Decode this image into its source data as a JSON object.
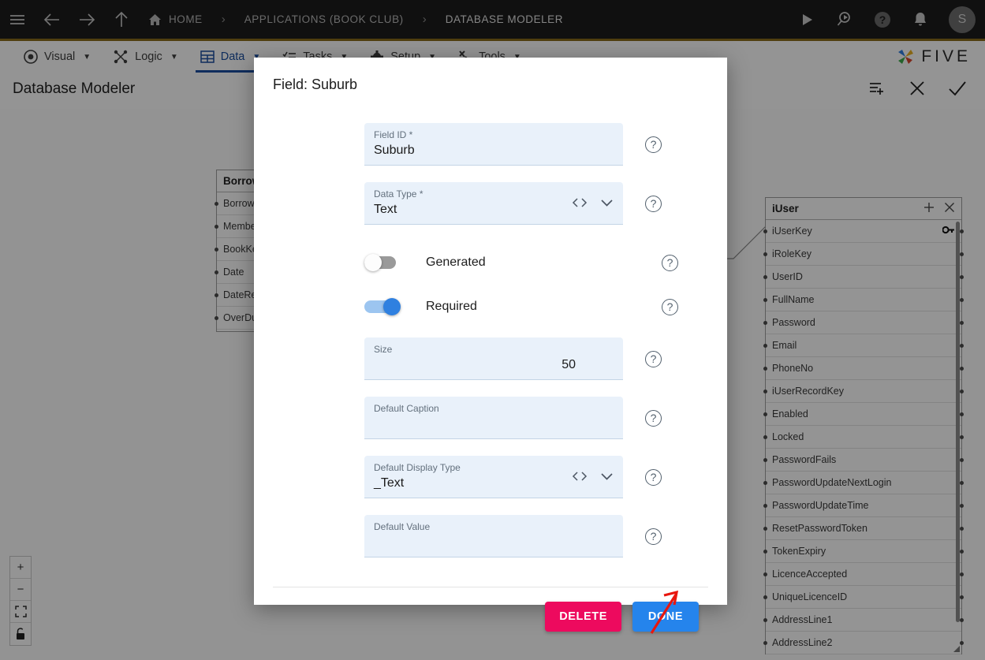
{
  "header": {
    "menu_icon": "hamburger-icon",
    "back_icon": "arrow-left-icon",
    "forward_icon": "arrow-right-icon",
    "up_icon": "arrow-up-icon",
    "breadcrumbs": [
      {
        "label": "HOME",
        "icon": "home-icon"
      },
      {
        "label": "APPLICATIONS (BOOK CLUB)"
      },
      {
        "label": "DATABASE MODELER"
      }
    ],
    "separator": "›",
    "actions": [
      {
        "name": "run-icon",
        "glyph": "play"
      },
      {
        "name": "search-icon",
        "glyph": "search"
      },
      {
        "name": "help-icon",
        "glyph": "question"
      },
      {
        "name": "notifications-icon",
        "glyph": "bell"
      }
    ],
    "avatar_initial": "S"
  },
  "modulebar": {
    "items": [
      {
        "label": "Visual",
        "icon": "eye-icon",
        "caret": "▼",
        "active": false
      },
      {
        "label": "Logic",
        "icon": "logic-nodes-icon",
        "caret": "▼",
        "active": false
      },
      {
        "label": "Data",
        "icon": "table-grid-icon",
        "caret": "▼",
        "active": true
      },
      {
        "label": "Tasks",
        "icon": "checklist-icon",
        "caret": "▼",
        "active": false
      },
      {
        "label": "Setup",
        "icon": "gear-icon",
        "caret": "▼",
        "active": false
      },
      {
        "label": "Tools",
        "icon": "wrench-icon",
        "caret": "▼",
        "active": false
      }
    ],
    "brand": "FIVE"
  },
  "page": {
    "title": "Database Modeler",
    "actions": [
      {
        "name": "add-record-icon",
        "glyph": "list-plus"
      },
      {
        "name": "close-icon",
        "glyph": "x"
      },
      {
        "name": "save-check-icon",
        "glyph": "check"
      }
    ]
  },
  "canvas": {
    "zoom_controls": [
      {
        "name": "zoom-in-button",
        "glyph": "+"
      },
      {
        "name": "zoom-out-button",
        "glyph": "−"
      },
      {
        "name": "fit-to-screen-button",
        "glyph": "fit"
      },
      {
        "name": "lock-canvas-button",
        "glyph": "lock"
      }
    ],
    "tables": [
      {
        "name": "BorrowHistory",
        "title": "BorrowH",
        "fields": [
          "BorrowH",
          "Member",
          "BookKey",
          "Date",
          "DateRetu",
          "OverDue"
        ]
      },
      {
        "name": "iUser",
        "title": "iUser",
        "add_icon": "plus-icon",
        "close_icon": "close-icon",
        "primary_key_icon": "key-icon",
        "fields": [
          {
            "label": "iUserKey",
            "key": true
          },
          {
            "label": "iRoleKey",
            "key": false
          },
          {
            "label": "UserID",
            "key": false
          },
          {
            "label": "FullName",
            "key": false
          },
          {
            "label": "Password",
            "key": false
          },
          {
            "label": "Email",
            "key": false
          },
          {
            "label": "PhoneNo",
            "key": false
          },
          {
            "label": "iUserRecordKey",
            "key": false
          },
          {
            "label": "Enabled",
            "key": false
          },
          {
            "label": "Locked",
            "key": false
          },
          {
            "label": "PasswordFails",
            "key": false
          },
          {
            "label": "PasswordUpdateNextLogin",
            "key": false
          },
          {
            "label": "PasswordUpdateTime",
            "key": false
          },
          {
            "label": "ResetPasswordToken",
            "key": false
          },
          {
            "label": "TokenExpiry",
            "key": false
          },
          {
            "label": "LicenceAccepted",
            "key": false
          },
          {
            "label": "UniqueLicenceID",
            "key": false
          },
          {
            "label": "AddressLine1",
            "key": false
          },
          {
            "label": "AddressLine2",
            "key": false
          }
        ]
      }
    ]
  },
  "modal": {
    "title": "Field: Suburb",
    "help_icon": "help-circle-icon",
    "code_icon": "code-brackets-icon",
    "dropdown_icon": "chevron-down-icon",
    "fields": [
      {
        "label": "Field ID *",
        "value": "Suburb",
        "type": "text",
        "placeholder": ""
      },
      {
        "label": "Data Type *",
        "value": "Text",
        "type": "select",
        "placeholder": ""
      },
      {
        "label": "Size",
        "value": "50",
        "type": "number",
        "placeholder": ""
      },
      {
        "label": "Default Caption",
        "value": "",
        "type": "text",
        "placeholder": ""
      },
      {
        "label": "Default Display Type",
        "value": "_Text",
        "type": "select",
        "placeholder": ""
      },
      {
        "label": "Default Value",
        "value": "",
        "type": "text",
        "placeholder": ""
      }
    ],
    "toggles": [
      {
        "label": "Generated",
        "on": false
      },
      {
        "label": "Required",
        "on": true
      }
    ],
    "buttons": {
      "delete": "DELETE",
      "done": "DONE"
    }
  },
  "colors": {
    "topbar_bg": "#1c1c1c",
    "topbar_accent": "#8a6d1a",
    "active_tab": "#1b4fa0",
    "input_bg": "#e9f1fa",
    "toggle_on": "#2f80e0",
    "delete_button": "#ed0a5e",
    "done_button": "#2584ec",
    "annotation_arrow": "#e8170f"
  }
}
